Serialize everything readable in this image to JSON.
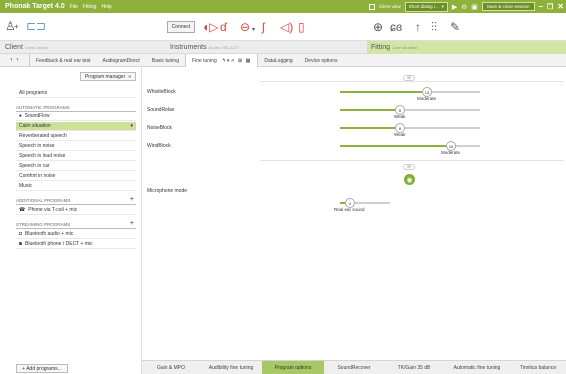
{
  "titlebar": {
    "app_title": "Phonak Target 4.0",
    "menus": [
      "File",
      "Fitting",
      "Help"
    ],
    "client_view": "Client view",
    "dialog_dropdown": "Short dialog i...",
    "save_close": "Save & close session"
  },
  "toolbar": {
    "connect_label": "Connect"
  },
  "infobar": {
    "client_label": "Client",
    "client_sub": "Smith James",
    "instruments_label": "Instruments",
    "instruments_sub": "Audéo V90-312T",
    "fitting_label": "Fitting",
    "fitting_sub": "Calm situation"
  },
  "tabs": [
    {
      "label": "Feedback & real ear test"
    },
    {
      "label": "AudiogramDirect"
    },
    {
      "label": "Basic tuning"
    },
    {
      "label": "Fine tuning"
    },
    {
      "label": "DataLogging"
    },
    {
      "label": "Device options"
    }
  ],
  "sidebar": {
    "program_manager": "Program manager",
    "all_programs": "All programs",
    "automatic_header": "AUTOMATIC PROGRAMS",
    "automatic": [
      "SoundFlow",
      "Calm situation",
      "Reverberated speech",
      "Speech in noise",
      "Speech in loud noise",
      "Speech in car",
      "Comfort in noise",
      "Music"
    ],
    "additional_header": "ADDITIONAL PROGRAMS",
    "additional": [
      "Phone via T-coil + mic"
    ],
    "streaming_header": "STREAMING PROGRAMS",
    "streaming": [
      "Bluetooth audio + mic",
      "Bluetooth phone / DECT + mic"
    ],
    "add_programs": "+ Add programs..."
  },
  "main": {
    "rows": [
      {
        "label": "WhistleBlock",
        "value": "13",
        "caption": "Moderate",
        "level": 0.62
      },
      {
        "label": "SoundRelax",
        "value": "8",
        "caption": "Weak",
        "level": 0.43
      },
      {
        "label": "NoiseBlock",
        "value": "8",
        "caption": "Weak",
        "level": 0.43
      },
      {
        "label": "WindBlock",
        "value": "16",
        "caption": "Moderate",
        "level": 0.79
      }
    ],
    "mic": {
      "label": "Microphone mode",
      "value": "4",
      "caption": "Real ear sound",
      "level": 0.2
    }
  },
  "bottom_tabs": [
    "Gain & MPO",
    "Audibility fine tuning",
    "Program options",
    "SoundRecover",
    "TK/Gain 35 dB",
    "Automatic fine tuning",
    "Tinnitus balance"
  ]
}
